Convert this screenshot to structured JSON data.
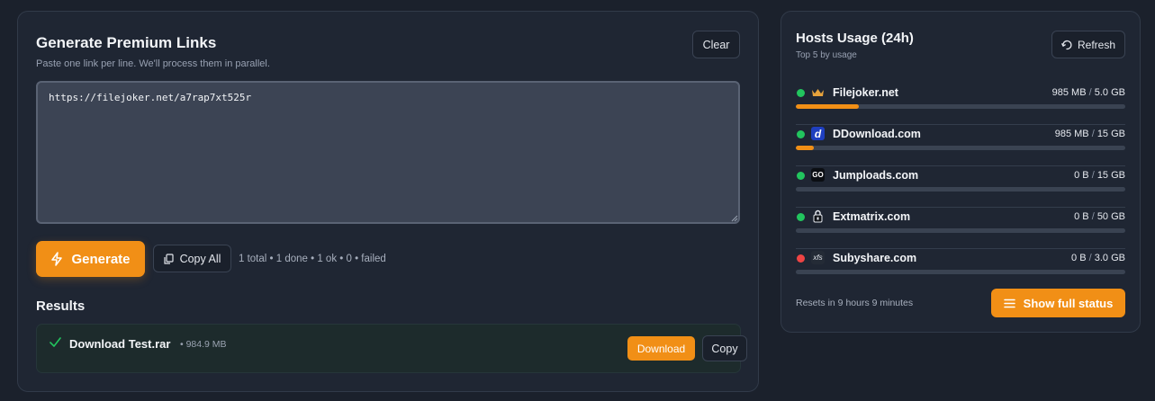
{
  "generator": {
    "title": "Generate Premium Links",
    "subtitle": "Paste one link per line. We'll process them in parallel.",
    "clear_label": "Clear",
    "textarea_value": "https://filejoker.net/a7rap7xt525r",
    "generate_label": "Generate",
    "copy_all_label": "Copy All",
    "stats": "1 total • 1 done • 1 ok • 0 • failed",
    "results_title": "Results",
    "results": [
      {
        "name": "Download Test.rar",
        "size": "• 984.9 MB",
        "status": "ok",
        "download_label": "Download",
        "copy_label": "Copy"
      }
    ]
  },
  "hosts": {
    "title": "Hosts Usage (24h)",
    "subtitle": "Top 5 by usage",
    "refresh_label": "Refresh",
    "items": [
      {
        "name": "Filejoker.net",
        "used": "985 MB",
        "limit": "5.0 GB",
        "fraction": 0.19,
        "status": "online",
        "icon": "crown-icon",
        "logo_text": ""
      },
      {
        "name": "DDownload.com",
        "used": "985 MB",
        "limit": "15 GB",
        "fraction": 0.056,
        "status": "online",
        "icon": "ddownload-logo-icon",
        "logo_text": "d"
      },
      {
        "name": "Jumploads.com",
        "used": "0 B",
        "limit": "15 GB",
        "fraction": 0,
        "status": "online",
        "icon": "jumploads-logo-icon",
        "logo_text": "GO"
      },
      {
        "name": "Extmatrix.com",
        "used": "0 B",
        "limit": "50 GB",
        "fraction": 0,
        "status": "online",
        "icon": "lock-icon",
        "logo_text": ""
      },
      {
        "name": "Subyshare.com",
        "used": "0 B",
        "limit": "3.0 GB",
        "fraction": 0,
        "status": "offline",
        "icon": "xfs-logo-icon",
        "logo_text": "xfs"
      }
    ],
    "reset_text": "Resets in 9 hours 9 minutes",
    "show_status_label": "Show full status"
  },
  "colors": {
    "accent": "#f18f16",
    "online": "#22c55e",
    "offline": "#ef4444",
    "panel": "#1f2633",
    "background": "#1b212c"
  }
}
